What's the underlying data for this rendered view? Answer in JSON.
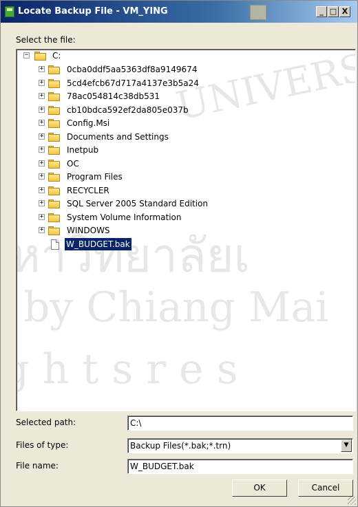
{
  "window": {
    "title": "Locate Backup File - VM_YING",
    "minimize_glyph": "_",
    "maximize_glyph": "□",
    "close_glyph": "X"
  },
  "labels": {
    "select_file": "Select the file:",
    "selected_path": "Selected path:",
    "files_of_type": "Files of type:",
    "file_name": "File name:"
  },
  "tree": {
    "root": {
      "label": "C:",
      "expander": "−"
    },
    "items": [
      {
        "label": "0cba0ddf5aa5363df8a9149674",
        "type": "folder",
        "expander": "+"
      },
      {
        "label": "5cd4efcb67d717a4137e3b5a24",
        "type": "folder",
        "expander": "+"
      },
      {
        "label": "78ac054814c38db531",
        "type": "folder",
        "expander": "+"
      },
      {
        "label": "cb10bdca592ef2da805e037b",
        "type": "folder",
        "expander": "+"
      },
      {
        "label": "Config.Msi",
        "type": "folder",
        "expander": "+"
      },
      {
        "label": "Documents and Settings",
        "type": "folder",
        "expander": "+"
      },
      {
        "label": "Inetpub",
        "type": "folder",
        "expander": "+"
      },
      {
        "label": "OC",
        "type": "folder",
        "expander": "+"
      },
      {
        "label": "Program Files",
        "type": "folder",
        "expander": "+"
      },
      {
        "label": "RECYCLER",
        "type": "folder",
        "expander": "+"
      },
      {
        "label": "SQL Server 2005 Standard Edition",
        "type": "folder",
        "expander": "+"
      },
      {
        "label": "System Volume Information",
        "type": "folder",
        "expander": "+"
      },
      {
        "label": "WINDOWS",
        "type": "folder",
        "expander": "+"
      },
      {
        "label": "W_BUDGET.bak",
        "type": "file",
        "selected": true
      }
    ]
  },
  "fields": {
    "selected_path": "C:\\",
    "files_of_type": "Backup Files(*.bak;*.trn)",
    "file_name": "W_BUDGET.bak"
  },
  "buttons": {
    "ok": "OK",
    "cancel": "Cancel"
  },
  "watermark": {
    "lines": [
      "UNIVERSI",
      "หาวิทยาลัยเ",
      "by Chiang Mai",
      "g h t s   r e s"
    ]
  },
  "colors": {
    "title_start": "#0a246a",
    "title_end": "#a6caf0",
    "selection": "#0a246a",
    "dialog_bg": "#ece9d8"
  }
}
